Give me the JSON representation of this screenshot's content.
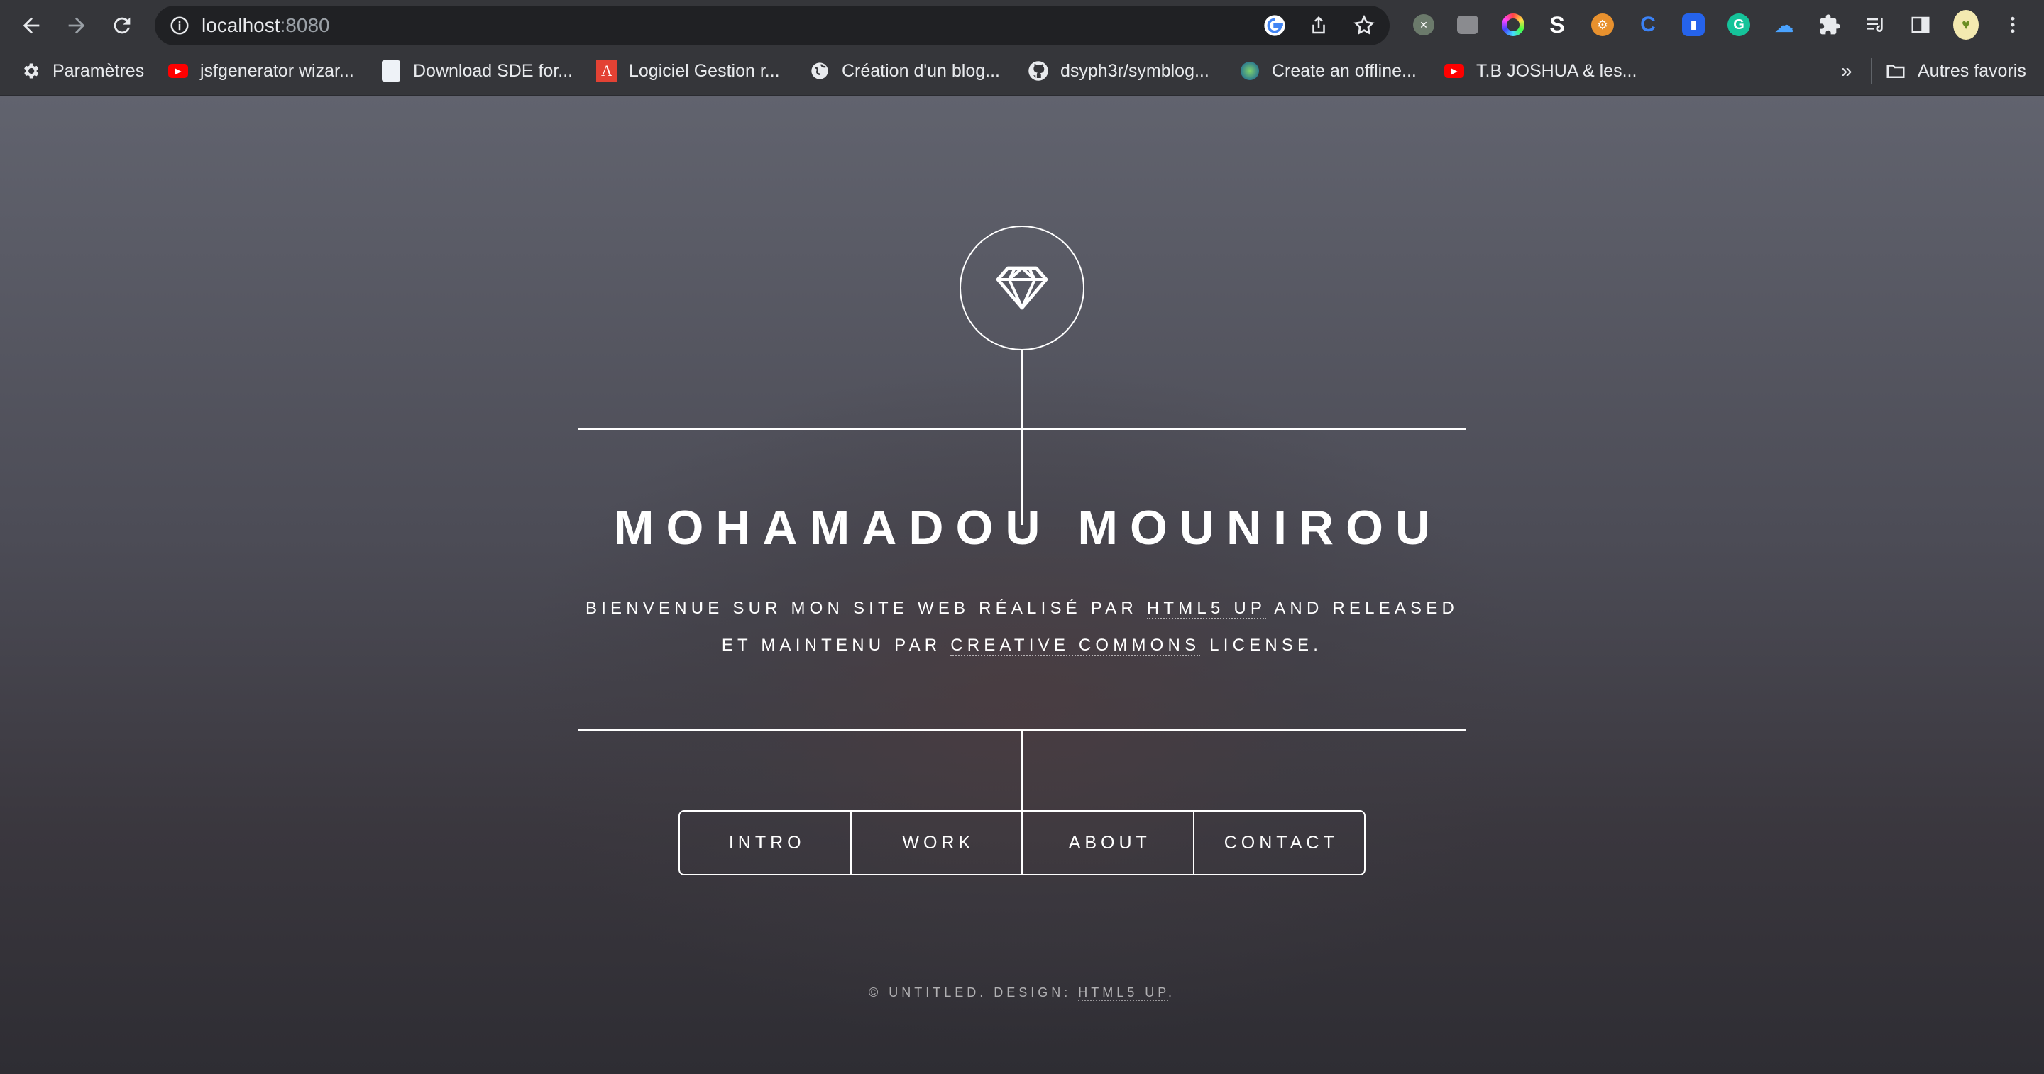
{
  "browser": {
    "url_host": "localhost",
    "url_port": ":8080",
    "bookmarks": [
      {
        "label": "Paramètres",
        "icon": "gear-icon"
      },
      {
        "label": "jsfgenerator wizar...",
        "icon": "youtube-icon"
      },
      {
        "label": "Download SDE for...",
        "icon": "document-icon"
      },
      {
        "label": "Logiciel Gestion r...",
        "icon": "acrobat-icon"
      },
      {
        "label": "Création d'un blog...",
        "icon": "globe-icon"
      },
      {
        "label": "dsyph3r/symblog...",
        "icon": "github-icon"
      },
      {
        "label": "Create an offline...",
        "icon": "network-icon"
      },
      {
        "label": "T.B JOSHUA & les...",
        "icon": "youtube-icon"
      }
    ],
    "overflow_label": "»",
    "other_bookmarks_label": "Autres favoris",
    "colors": {
      "chrome": "#35363a",
      "omnibox": "#202124",
      "text": "#e8eaed"
    }
  },
  "page": {
    "title": "MOHAMADOU MOUNIROU",
    "intro": {
      "line1_pre": "BIENVENUE SUR MON SITE WEB RÉALISÉ PAR ",
      "line1_link": "HTML5 UP",
      "line1_post": " AND RELEASED",
      "line2_pre": "ET MAINTENU PAR ",
      "line2_link": "CREATIVE COMMONS",
      "line2_post": " LICENSE."
    },
    "nav": [
      "INTRO",
      "WORK",
      "ABOUT",
      "CONTACT"
    ],
    "footer": {
      "pre": "© UNTITLED. DESIGN: ",
      "link": "HTML5 UP",
      "post": "."
    },
    "logo_icon": "diamond-icon"
  }
}
